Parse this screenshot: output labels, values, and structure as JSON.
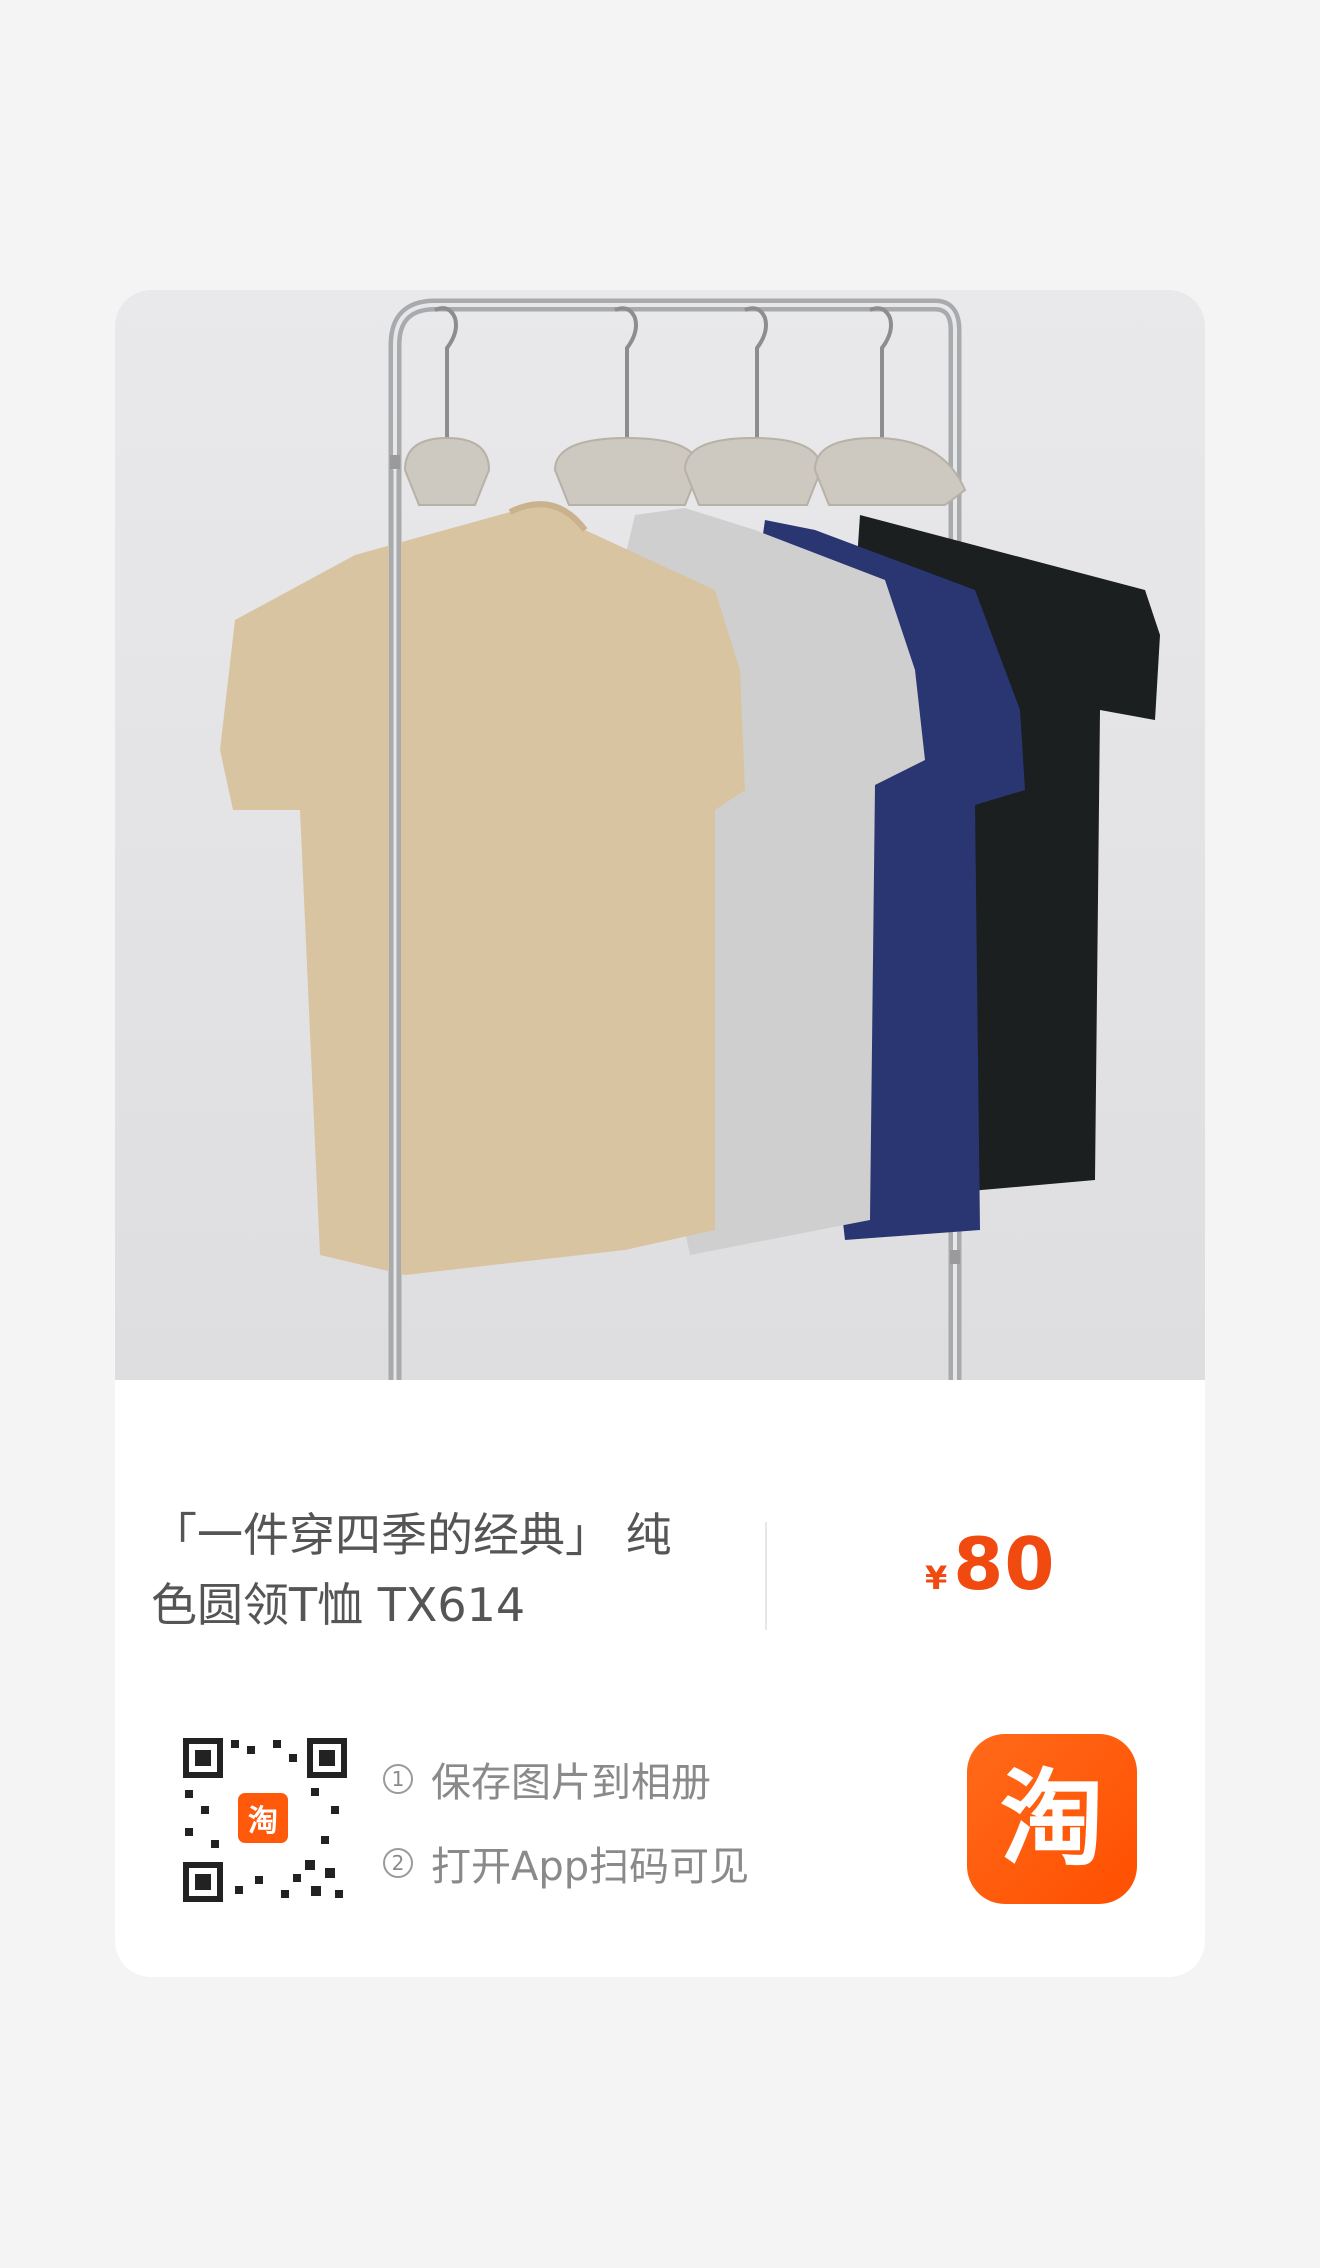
{
  "product": {
    "title": "「一件穿四季的经典」 纯\n色圆领T恤 TX614",
    "price_symbol": "¥",
    "price": "80",
    "image_alt": "四件纯色圆领T恤挂在金属衣架上（卡其、灰、藏青、黑）"
  },
  "instructions": {
    "step1_num": "1",
    "step1": "保存图片到相册",
    "step2_num": "2",
    "step2": "打开App扫码可见"
  },
  "app": {
    "icon_glyph": "淘",
    "qr_logo_glyph": "淘"
  },
  "colors": {
    "accent": "#ff5000",
    "price": "#f04a10",
    "shirts": [
      "#d9c4a2",
      "#cfcfcf",
      "#2a3672",
      "#1b1f20"
    ]
  }
}
